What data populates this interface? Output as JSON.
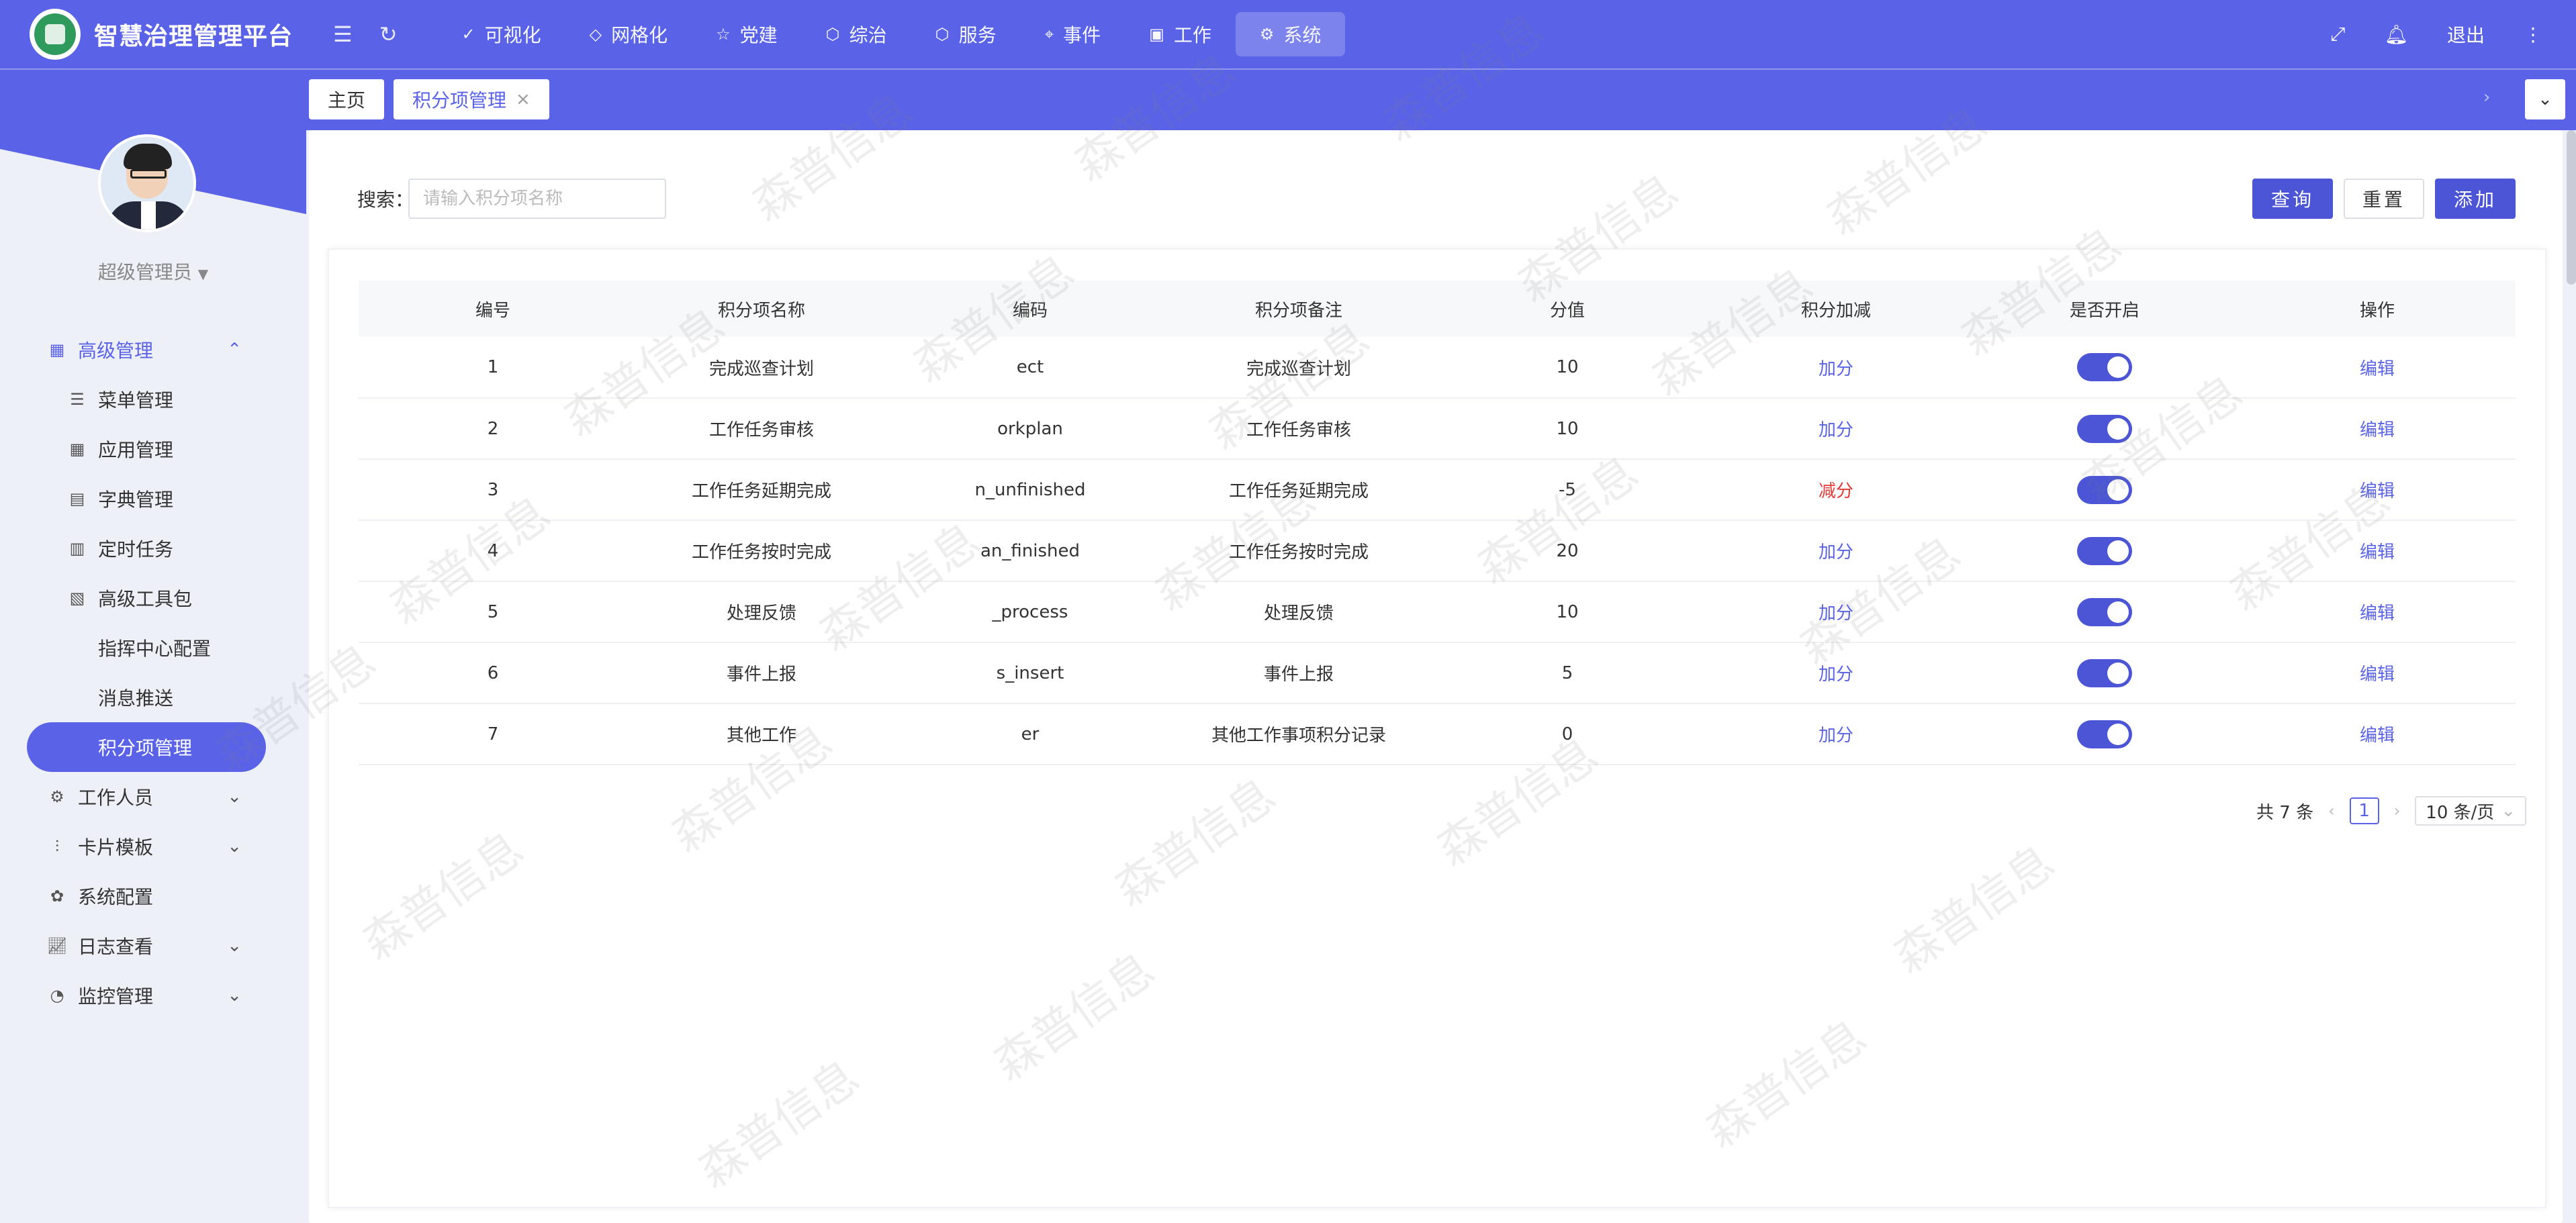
{
  "app": {
    "title": "智慧治理管理平台"
  },
  "nav": {
    "items": [
      {
        "label": "可视化",
        "icon": "check-circle-icon"
      },
      {
        "label": "网格化",
        "icon": "diamond-icon"
      },
      {
        "label": "党建",
        "icon": "star-icon"
      },
      {
        "label": "综治",
        "icon": "hexagon-icon"
      },
      {
        "label": "服务",
        "icon": "hexagon-icon"
      },
      {
        "label": "事件",
        "icon": "location-pin-icon"
      },
      {
        "label": "工作",
        "icon": "briefcase-icon"
      },
      {
        "label": "系统",
        "icon": "gear-icon",
        "active": true
      }
    ],
    "logout": "退出"
  },
  "user": {
    "name": "超级管理员"
  },
  "sidebar": {
    "groups": [
      {
        "label": "高级管理",
        "open": true
      },
      {
        "label": "菜单管理"
      },
      {
        "label": "应用管理"
      },
      {
        "label": "字典管理"
      },
      {
        "label": "定时任务"
      },
      {
        "label": "高级工具包"
      },
      {
        "label": "指挥中心配置"
      },
      {
        "label": "消息推送"
      },
      {
        "label": "积分项管理",
        "selected": true
      },
      {
        "label": "工作人员"
      },
      {
        "label": "卡片模板"
      },
      {
        "label": "系统配置"
      },
      {
        "label": "日志查看"
      },
      {
        "label": "监控管理"
      }
    ]
  },
  "tabs": {
    "home": "主页",
    "active": "积分项管理",
    "close": "×"
  },
  "search": {
    "label": "搜索：",
    "placeholder": "请输入积分项名称",
    "value": ""
  },
  "buttons": {
    "query": "查询",
    "reset": "重置",
    "add": "添加"
  },
  "table": {
    "headers": [
      "编号",
      "积分项名称",
      "编码",
      "积分项备注",
      "分值",
      "积分加减",
      "是否开启",
      "操作"
    ],
    "rows": [
      {
        "id": "1",
        "name": "完成巡查计划",
        "code": "ect",
        "note": "完成巡查计划",
        "score": "10",
        "op": "加分",
        "enabled": true,
        "action": "编辑"
      },
      {
        "id": "2",
        "name": "工作任务审核",
        "code": "orkplan",
        "note": "工作任务审核",
        "score": "10",
        "op": "加分",
        "enabled": true,
        "action": "编辑"
      },
      {
        "id": "3",
        "name": "工作任务延期完成",
        "code": "n_unfinished",
        "note": "工作任务延期完成",
        "score": "-5",
        "op": "减分",
        "enabled": true,
        "action": "编辑"
      },
      {
        "id": "4",
        "name": "工作任务按时完成",
        "code": "an_finished",
        "note": "工作任务按时完成",
        "score": "20",
        "op": "加分",
        "enabled": true,
        "action": "编辑"
      },
      {
        "id": "5",
        "name": "处理反馈",
        "code": "_process",
        "note": "处理反馈",
        "score": "10",
        "op": "加分",
        "enabled": true,
        "action": "编辑"
      },
      {
        "id": "6",
        "name": "事件上报",
        "code": "s_insert",
        "note": "事件上报",
        "score": "5",
        "op": "加分",
        "enabled": true,
        "action": "编辑"
      },
      {
        "id": "7",
        "name": "其他工作",
        "code": "er",
        "note": "其他工作事项积分记录",
        "score": "0",
        "op": "加分",
        "enabled": true,
        "action": "编辑"
      }
    ]
  },
  "pagination": {
    "total": "共 7 条",
    "current": "1",
    "page_size": "10 条/页"
  },
  "watermark": "森普信息",
  "colors": {
    "primary": "#5a63e8",
    "danger": "#e53935"
  }
}
